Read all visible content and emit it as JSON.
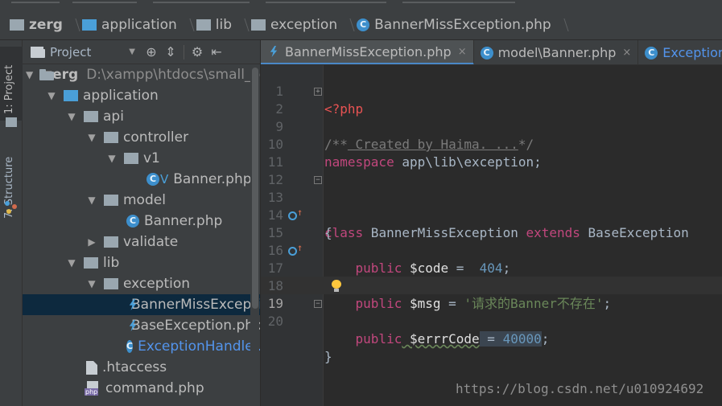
{
  "breadcrumb": [
    {
      "label": "zerg",
      "icon": "folder-icon",
      "bold": true
    },
    {
      "label": "application",
      "icon": "folder-icon"
    },
    {
      "label": "lib",
      "icon": "folder-icon"
    },
    {
      "label": "exception",
      "icon": "folder-icon"
    },
    {
      "label": "BannerMissException.php",
      "icon": "class-icon"
    }
  ],
  "toolwindow_tabs": {
    "project": "1: Project",
    "structure": "7: Structure"
  },
  "project_panel": {
    "view_selector": "Project",
    "tree": [
      {
        "label": "zerg",
        "path": "D:\\xampp\\htdocs\\small_p",
        "depth": 0,
        "expanded": true,
        "icon": "folder-icon",
        "bold": true
      },
      {
        "label": "application",
        "depth": 1,
        "expanded": true,
        "icon": "folder-icon"
      },
      {
        "label": "api",
        "depth": 2,
        "expanded": true,
        "icon": "folder-icon"
      },
      {
        "label": "controller",
        "depth": 3,
        "expanded": true,
        "icon": "folder-icon"
      },
      {
        "label": "v1",
        "depth": 4,
        "expanded": true,
        "icon": "folder-icon"
      },
      {
        "label": "Banner.php",
        "depth": 5,
        "icon": "class-icon",
        "badge": "V"
      },
      {
        "label": "model",
        "depth": 3,
        "expanded": true,
        "icon": "folder-icon"
      },
      {
        "label": "Banner.php",
        "depth": 4,
        "icon": "class-icon"
      },
      {
        "label": "validate",
        "depth": 3,
        "expanded": false,
        "icon": "folder-icon"
      },
      {
        "label": "lib",
        "depth": 2,
        "expanded": true,
        "icon": "folder-icon"
      },
      {
        "label": "exception",
        "depth": 3,
        "expanded": true,
        "icon": "folder-icon"
      },
      {
        "label": "BannerMissExcepti",
        "depth": 4,
        "icon": "exception-icon",
        "selected": true
      },
      {
        "label": "BaseException.php",
        "depth": 4,
        "icon": "exception-icon"
      },
      {
        "label": "ExceptionHandler.p",
        "depth": 4,
        "icon": "class-icon",
        "link": true
      },
      {
        "label": ".htaccess",
        "depth": 3,
        "icon": "file-icon"
      },
      {
        "label": "command.php",
        "depth": 3,
        "icon": "php-file-icon"
      }
    ]
  },
  "editor_tabs": [
    {
      "label": "BannerMissException.php",
      "icon": "exception-icon",
      "active": true,
      "close": "×"
    },
    {
      "label": "model\\Banner.php",
      "icon": "class-icon",
      "close": "×"
    },
    {
      "label": "ExceptionH",
      "icon": "class-icon",
      "partial": true
    }
  ],
  "code_lines": [
    {
      "num": "1"
    },
    {
      "num": "2"
    },
    {
      "num": "9"
    },
    {
      "num": "10"
    },
    {
      "num": "11"
    },
    {
      "num": "12"
    },
    {
      "num": "13"
    },
    {
      "num": "14"
    },
    {
      "num": "15"
    },
    {
      "num": "16"
    },
    {
      "num": "17"
    },
    {
      "num": "18"
    },
    {
      "num": "19"
    },
    {
      "num": "20"
    }
  ],
  "code": {
    "php_open": "<?php",
    "doc_open": "/**",
    "doc_folded": " Created by Haima. ...",
    "doc_close": "*/",
    "namespace_kw": "namespace",
    "namespace_path": " app\\lib\\exception;",
    "class_kw": "class",
    "class_name": " BannerMissException ",
    "extends_kw": "extends",
    "parent_class": " BaseException",
    "brace_open": "{",
    "public_kw": "public",
    "code_var": " $code",
    "assign": " = ",
    "code_val": " 404",
    "semi": ";",
    "msg_var": " $msg",
    "msg_val": "'请求的Banner不存在'",
    "errr_var": " $errrCode",
    "errr_assign": " = ",
    "errr_val": "40000",
    "brace_close": "}"
  },
  "watermark": "https://blog.csdn.net/u010924692"
}
